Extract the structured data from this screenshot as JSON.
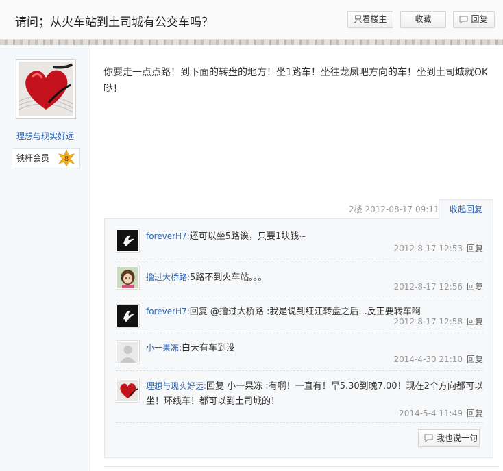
{
  "header": {
    "title": "请问；从火车站到土司城有公交车吗？",
    "only_op_label": "只看楼主",
    "favorite_label": "收藏",
    "reply_label": "回复"
  },
  "author": {
    "name": "理想与现实好远",
    "member_level": "铁杆会员",
    "level_number": "8"
  },
  "post": {
    "content": "你要走一点点路！到下面的转盘的地方！坐1路车！坐往龙凤吧方向的车！坐到土司城就OK哒！",
    "floor_info": "2楼  2012-08-17 09:11",
    "collapse_label": "收起回复"
  },
  "comments": [
    {
      "user": "foreverH7:",
      "text": "还可以坐5路诶，只要1块钱~",
      "time": "2012-8-17 12:53",
      "reply": "回复"
    },
    {
      "user": "撸过大桥路:",
      "text": "5路不到火车站。。。",
      "time": "2012-8-17 12:56",
      "reply": "回复"
    },
    {
      "user": "foreverH7:",
      "text": "回复 @撸过大桥路 :我是说到红江转盘之后...反正要转车啊",
      "time": "2012-8-17 12:58",
      "reply": "回复"
    },
    {
      "user": "小一果冻:",
      "text": "白天有车到没",
      "time": "2014-4-30 21:10",
      "reply": "回复"
    },
    {
      "user": "理想与现实好远:",
      "text": "回复 小一果冻 :有啊！一直有！早5.30到晚7.00！现在2个方向都可以坐！环线车！都可以到土司城的！",
      "time": "2014-5-4 11:49",
      "reply": "回复"
    }
  ],
  "say_label": "我也说一句",
  "colors": {
    "link": "#2d64b3",
    "meta": "#999999"
  }
}
